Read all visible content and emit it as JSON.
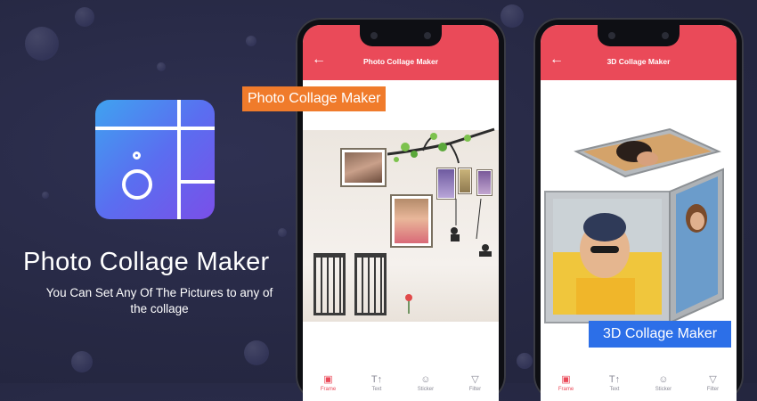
{
  "promo": {
    "title": "Photo Collage Maker",
    "subtitle": "You Can Set Any Of The Pictures to any of the collage",
    "badge_left": "Photo Collage Maker",
    "badge_right": "3D Collage Maker"
  },
  "phone1": {
    "screen_title": "Photo Collage Maker",
    "back_icon": "arrow-left-icon",
    "nav": [
      {
        "label": "Frame",
        "icon": "frame-icon",
        "active": true
      },
      {
        "label": "Text",
        "icon": "text-icon",
        "active": false
      },
      {
        "label": "Sticker",
        "icon": "sticker-icon",
        "active": false
      },
      {
        "label": "Filter",
        "icon": "filter-icon",
        "active": false
      }
    ]
  },
  "phone2": {
    "screen_title": "3D Collage Maker",
    "back_icon": "arrow-left-icon",
    "nav": [
      {
        "label": "Frame",
        "icon": "frame-icon",
        "active": true
      },
      {
        "label": "Text",
        "icon": "text-icon",
        "active": false
      },
      {
        "label": "Sticker",
        "icon": "sticker-icon",
        "active": false
      },
      {
        "label": "Filter",
        "icon": "filter-icon",
        "active": false
      }
    ]
  },
  "colors": {
    "background": "#262843",
    "topbar": "#ea4a59",
    "badge_orange": "#f07b2b",
    "badge_blue": "#2c6fe8"
  }
}
